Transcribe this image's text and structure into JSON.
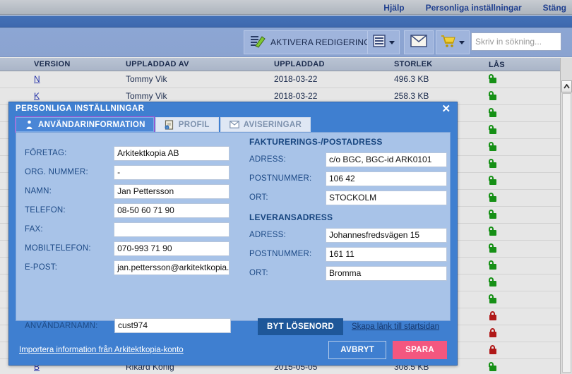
{
  "topbar": {
    "links": [
      {
        "label": "Hjälp",
        "name": "help-link"
      },
      {
        "label": "Personliga inställningar",
        "name": "personal-settings-link"
      },
      {
        "label": "Stäng",
        "name": "close-link"
      }
    ]
  },
  "toolbar": {
    "edit_label": "AKTIVERA REDIGERING",
    "edit_icon": "pencil-list-icon",
    "list_icon": "list-icon",
    "mail_icon": "envelope-icon",
    "cart_icon": "shopping-cart-icon",
    "search_placeholder": "Skriv in sökning...",
    "search_value": "",
    "search_icon": "magnifier-icon"
  },
  "table": {
    "columns": [
      "VERSION",
      "UPPLADDAD AV",
      "UPPLADDAD",
      "STORLEK",
      "LÅS"
    ],
    "rows": [
      {
        "version": "N",
        "by": "Tommy Vik",
        "date": "2018-03-22",
        "size": "496.3 KB",
        "lock": "open"
      },
      {
        "version": "K",
        "by": "Tommy Vik",
        "date": "2018-03-22",
        "size": "258.3 KB",
        "lock": "open"
      },
      {
        "version": "",
        "by": "",
        "date": "",
        "size": "",
        "lock": "open"
      },
      {
        "version": "",
        "by": "",
        "date": "",
        "size": "",
        "lock": "open"
      },
      {
        "version": "",
        "by": "",
        "date": "",
        "size": "",
        "lock": "open"
      },
      {
        "version": "",
        "by": "",
        "date": "",
        "size": "",
        "lock": "open"
      },
      {
        "version": "",
        "by": "",
        "date": "",
        "size": "",
        "lock": "open"
      },
      {
        "version": "",
        "by": "",
        "date": "",
        "size": "",
        "lock": "open"
      },
      {
        "version": "",
        "by": "",
        "date": "",
        "size": "",
        "lock": "open"
      },
      {
        "version": "",
        "by": "",
        "date": "",
        "size": "",
        "lock": "open"
      },
      {
        "version": "",
        "by": "",
        "date": "",
        "size": "",
        "lock": "open"
      },
      {
        "version": "",
        "by": "",
        "date": "",
        "size": "",
        "lock": "open"
      },
      {
        "version": "",
        "by": "",
        "date": "",
        "size": "",
        "lock": "open"
      },
      {
        "version": "",
        "by": "",
        "date": "",
        "size": "",
        "lock": "open"
      },
      {
        "version": "",
        "by": "",
        "date": "",
        "size": "",
        "lock": "closed"
      },
      {
        "version": "",
        "by": "",
        "date": "",
        "size": "",
        "lock": "closed"
      },
      {
        "version": "",
        "by": "",
        "date": "",
        "size": "",
        "lock": "closed"
      },
      {
        "version": "B",
        "by": "Rikard König",
        "date": "2015-05-05",
        "size": "308.5 KB",
        "lock": "open"
      }
    ]
  },
  "dialog": {
    "title": "PERSONLIGA INSTÄLLNINGAR",
    "close_icon": "close-icon",
    "tabs": [
      {
        "label": "ANVÄNDARINFORMATION",
        "icon": "user-icon",
        "active": true
      },
      {
        "label": "PROFIL",
        "icon": "profile-card-icon",
        "active": false
      },
      {
        "label": "AVISERINGAR",
        "icon": "envelope-icon",
        "active": false
      }
    ],
    "left_fields": [
      {
        "label": "FÖRETAG:",
        "value": "Arkitektkopia AB"
      },
      {
        "label": "ORG. NUMMER:",
        "value": "-"
      },
      {
        "label": "NAMN:",
        "value": "Jan Pettersson"
      },
      {
        "label": "TELEFON:",
        "value": "08-50 60 71 90"
      },
      {
        "label": "FAX:",
        "value": ""
      },
      {
        "label": "MOBILTELEFON:",
        "value": "070-993 71 90"
      },
      {
        "label": "E-POST:",
        "value": "jan.pettersson@arkitektkopia.s"
      }
    ],
    "billing": {
      "heading": "FAKTURERINGS-/POSTADRESS",
      "fields": [
        {
          "label": "ADRESS:",
          "value": "c/o BGC, BGC-id ARK0101"
        },
        {
          "label": "POSTNUMMER:",
          "value": "106 42"
        },
        {
          "label": "ORT:",
          "value": "STOCKOLM"
        }
      ]
    },
    "delivery": {
      "heading": "LEVERANSADRESS",
      "fields": [
        {
          "label": "ADRESS:",
          "value": "Johannesfredsvägen 15"
        },
        {
          "label": "POSTNUMMER:",
          "value": "161 11"
        },
        {
          "label": "ORT:",
          "value": "Bromma"
        }
      ]
    },
    "username": {
      "label": "ANVÄNDARNAMN:",
      "value": "cust974"
    },
    "change_password_label": "BYT LÖSENORD",
    "start_link_label": "Skapa länk till startsidan",
    "import_link_label": "Importera information från Arkitektkopia-konto",
    "cancel_label": "AVBRYT",
    "save_label": "SPARA"
  },
  "colors": {
    "dialog_blue": "#3f7fd0",
    "panel_blue": "#a8c3e8",
    "save_pink": "#f4577f",
    "password_blue": "#1e5799",
    "tab_focus_purple": "#b84ad2",
    "lock_open_green": "#169016",
    "lock_closed_red": "#b01818"
  }
}
